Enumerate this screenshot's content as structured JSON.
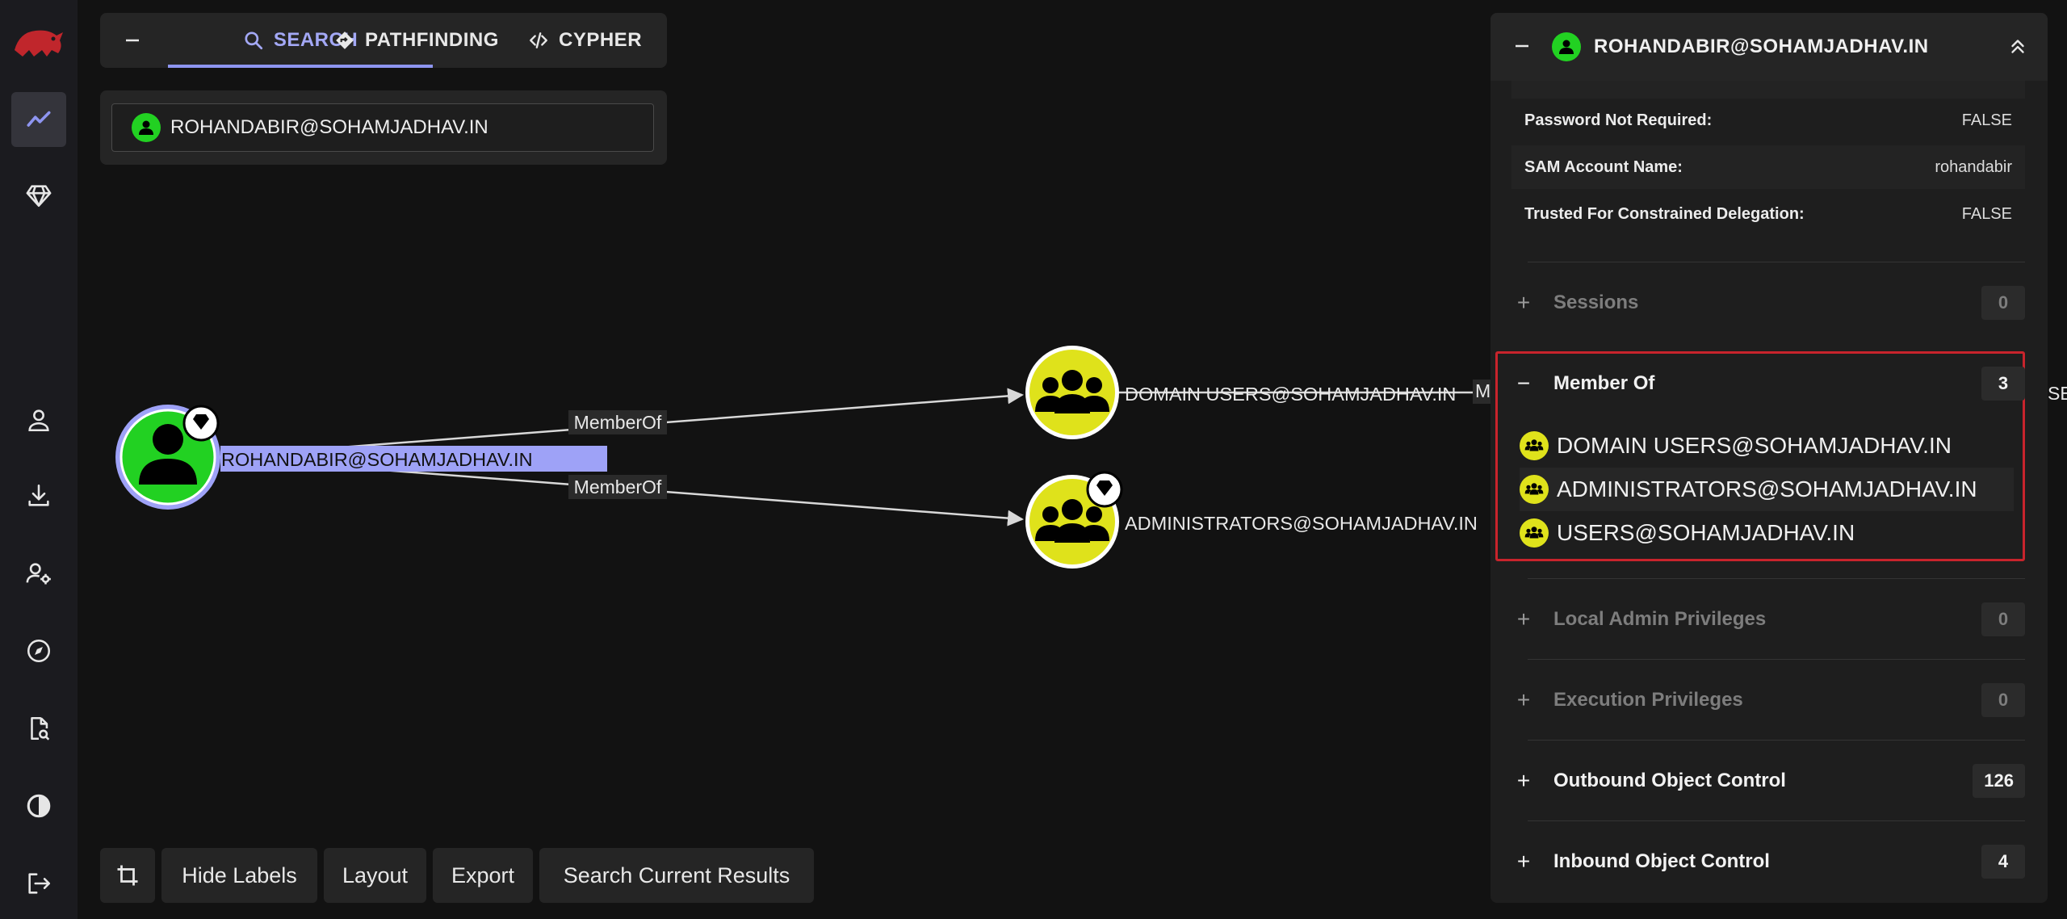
{
  "tabs": [
    {
      "label": "SEARCH",
      "active": true,
      "icon": "search-icon"
    },
    {
      "label": "PATHFINDING",
      "icon": "diamond-arrow-icon"
    },
    {
      "label": "CYPHER",
      "icon": "code-icon"
    }
  ],
  "search": {
    "value": "ROHANDABIR@SOHAMJADHAV.IN"
  },
  "graph": {
    "nodes": [
      {
        "label": "ROHANDABIR@SOHAMJADHAV.IN",
        "type": "user",
        "highvalue": true,
        "selected": true
      },
      {
        "label": "DOMAIN USERS@SOHAMJADHAV.IN",
        "type": "group",
        "highvalue": false
      },
      {
        "label": "ADMINISTRATORS@SOHAMJADHAV.IN",
        "type": "group",
        "highvalue": true
      }
    ],
    "edges": [
      {
        "label": "MemberOf",
        "from": "ROHANDABIR@SOHAMJADHAV.IN",
        "to": "DOMAIN USERS@SOHAMJADHAV.IN"
      },
      {
        "label": "MemberOf",
        "from": "ROHANDABIR@SOHAMJADHAV.IN",
        "to": "ADMINISTRATORS@SOHAMJADHAV.IN"
      }
    ],
    "edge_cut_label": "M",
    "node_cut_label": "SE"
  },
  "toolbar": {
    "hide_labels": "Hide Labels",
    "layout": "Layout",
    "export": "Export",
    "search_current": "Search Current Results"
  },
  "panel": {
    "title": "ROHANDABIR@SOHAMJADHAV.IN",
    "properties": [
      {
        "key": "Password Not Required:",
        "value": "FALSE"
      },
      {
        "key": "SAM Account Name:",
        "value": "rohandabir"
      },
      {
        "key": "Trusted For Constrained Delegation:",
        "value": "FALSE"
      }
    ],
    "sections": [
      {
        "label": "Sessions",
        "count": "0",
        "toggle": "+"
      },
      {
        "label": "Member Of",
        "count": "3",
        "toggle": "−"
      },
      {
        "label": "Local Admin Privileges",
        "count": "0",
        "toggle": "+"
      },
      {
        "label": "Execution Privileges",
        "count": "0",
        "toggle": "+"
      },
      {
        "label": "Outbound Object Control",
        "count": "126",
        "toggle": "+"
      },
      {
        "label": "Inbound Object Control",
        "count": "4",
        "toggle": "+"
      }
    ],
    "member_of": [
      "DOMAIN USERS@SOHAMJADHAV.IN",
      "ADMINISTRATORS@SOHAMJADHAV.IN",
      "USERS@SOHAMJADHAV.IN"
    ]
  },
  "colors": {
    "accent": "#8e95f0",
    "user_node": "#22d122",
    "group_node": "#dfe21b",
    "highlight_border": "#c8242c",
    "background": "#121212"
  },
  "icons": {
    "logo": "bloodhound-logo",
    "sidebar": [
      "graph-trend-icon",
      "gem-icon",
      "user-icon",
      "download-icon",
      "user-gear-icon",
      "compass-icon",
      "file-search-icon",
      "contrast-icon",
      "logout-icon"
    ]
  }
}
